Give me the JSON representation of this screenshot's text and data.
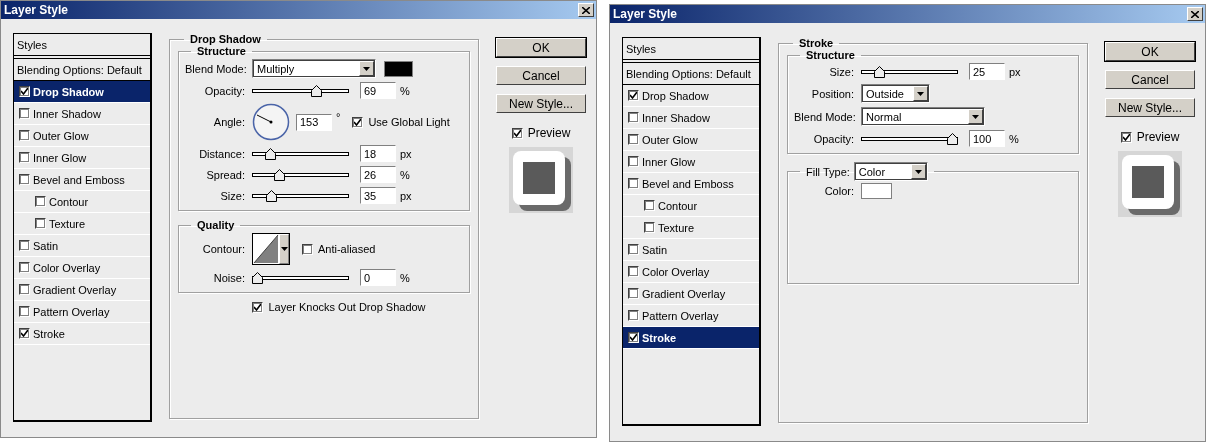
{
  "dialogs": [
    {
      "title": "Layer Style",
      "styles_header": "Styles",
      "blending_options": "Blending Options: Default",
      "effects": [
        {
          "label": "Drop Shadow",
          "checked": true,
          "selected": true
        },
        {
          "label": "Inner Shadow",
          "checked": false,
          "selected": false
        },
        {
          "label": "Outer Glow",
          "checked": false,
          "selected": false
        },
        {
          "label": "Inner Glow",
          "checked": false,
          "selected": false
        },
        {
          "label": "Bevel and Emboss",
          "checked": false,
          "selected": false,
          "children": [
            {
              "label": "Contour",
              "checked": false,
              "selected": false
            },
            {
              "label": "Texture",
              "checked": false,
              "selected": false
            }
          ]
        },
        {
          "label": "Satin",
          "checked": false,
          "selected": false
        },
        {
          "label": "Color Overlay",
          "checked": false,
          "selected": false
        },
        {
          "label": "Gradient Overlay",
          "checked": false,
          "selected": false
        },
        {
          "label": "Pattern Overlay",
          "checked": false,
          "selected": false
        },
        {
          "label": "Stroke",
          "checked": true,
          "selected": false
        }
      ],
      "panel": {
        "title": "Drop Shadow",
        "groups": [
          {
            "title": "Structure",
            "rows": [
              {
                "kind": "dropdown",
                "label": "Blend Mode:",
                "value": "Multiply",
                "color": "#000000"
              },
              {
                "kind": "slider",
                "label": "Opacity:",
                "level": 0.69,
                "value": "69",
                "unit": "%"
              },
              {
                "kind": "angle",
                "label": "Angle:",
                "value": "153",
                "unit": "°",
                "checkbox": {
                  "label": "Use Global Light",
                  "checked": true
                }
              },
              {
                "kind": "slider",
                "label": "Distance:",
                "level": 0.15,
                "value": "18",
                "unit": "px"
              },
              {
                "kind": "slider",
                "label": "Spread:",
                "level": 0.26,
                "value": "26",
                "unit": "%"
              },
              {
                "kind": "slider",
                "label": "Size:",
                "level": 0.16,
                "value": "35",
                "unit": "px"
              }
            ]
          },
          {
            "title": "Quality",
            "rows": [
              {
                "kind": "contour",
                "label": "Contour:",
                "checkbox": {
                  "label": "Anti-aliased",
                  "checked": false
                }
              },
              {
                "kind": "slider",
                "label": "Noise:",
                "level": 0,
                "value": "0",
                "unit": "%"
              }
            ]
          }
        ],
        "footer_checkbox": {
          "label": "Layer Knocks Out Drop Shadow",
          "checked": true
        }
      },
      "buttons": [
        "OK",
        "Cancel",
        "New Style..."
      ],
      "preview": {
        "label": "Preview",
        "checked": true
      }
    },
    {
      "title": "Layer Style",
      "styles_header": "Styles",
      "blending_options": "Blending Options: Default",
      "effects": [
        {
          "label": "Drop Shadow",
          "checked": true,
          "selected": false
        },
        {
          "label": "Inner Shadow",
          "checked": false,
          "selected": false
        },
        {
          "label": "Outer Glow",
          "checked": false,
          "selected": false
        },
        {
          "label": "Inner Glow",
          "checked": false,
          "selected": false
        },
        {
          "label": "Bevel and Emboss",
          "checked": false,
          "selected": false,
          "children": [
            {
              "label": "Contour",
              "checked": false,
              "selected": false
            },
            {
              "label": "Texture",
              "checked": false,
              "selected": false
            }
          ]
        },
        {
          "label": "Satin",
          "checked": false,
          "selected": false
        },
        {
          "label": "Color Overlay",
          "checked": false,
          "selected": false
        },
        {
          "label": "Gradient Overlay",
          "checked": false,
          "selected": false
        },
        {
          "label": "Pattern Overlay",
          "checked": false,
          "selected": false
        },
        {
          "label": "Stroke",
          "checked": true,
          "selected": true
        }
      ],
      "panel": {
        "title": "Stroke",
        "groups": [
          {
            "title": "Structure",
            "rows": [
              {
                "kind": "slider",
                "label": "Size:",
                "level": 0.15,
                "value": "25",
                "unit": "px"
              },
              {
                "kind": "short_dropdown",
                "label": "Position:",
                "value": "Outside"
              },
              {
                "kind": "dropdown",
                "label": "Blend Mode:",
                "value": "Normal"
              },
              {
                "kind": "slider",
                "label": "Opacity:",
                "level": 1,
                "value": "100",
                "unit": "%"
              }
            ]
          },
          {
            "title_dropdown": {
              "label": "Fill Type:",
              "value": "Color"
            },
            "rows": [
              {
                "kind": "color",
                "label": "Color:",
                "color": "#ffffff"
              }
            ]
          }
        ]
      },
      "buttons": [
        "OK",
        "Cancel",
        "New Style..."
      ],
      "preview": {
        "label": "Preview",
        "checked": true
      }
    }
  ]
}
